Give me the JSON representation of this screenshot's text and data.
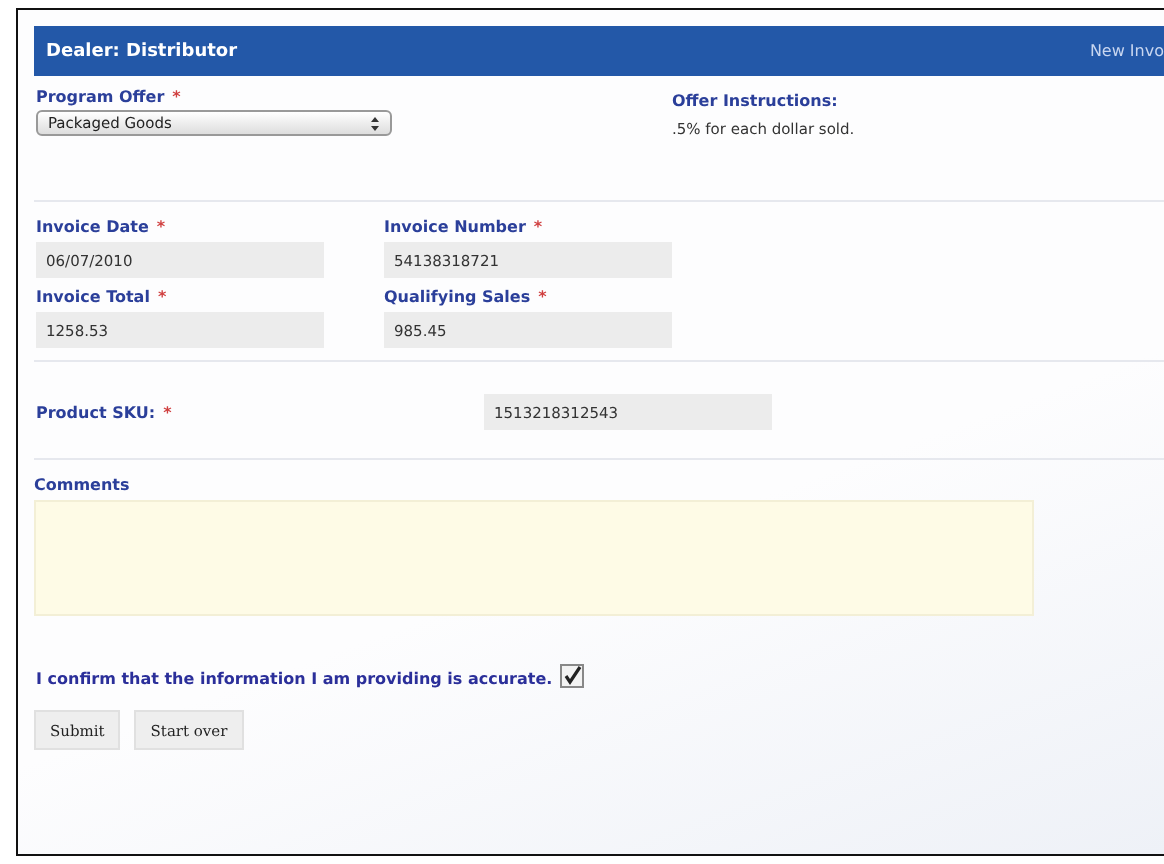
{
  "header": {
    "title": "Dealer: Distributor",
    "link": "New Invo"
  },
  "program_offer": {
    "label": "Program Offer",
    "required_mark": "*",
    "value": "Packaged Goods"
  },
  "offer_instructions": {
    "label": "Offer Instructions:",
    "text": ".5% for each dollar sold."
  },
  "fields": [
    {
      "label": "Invoice Date",
      "required_mark": "*",
      "value": "06/07/2010"
    },
    {
      "label": "Invoice Number",
      "required_mark": "*",
      "value": "54138318721"
    },
    {
      "label": "Invoice Total",
      "required_mark": "*",
      "value": "1258.53"
    },
    {
      "label": "Qualifying Sales",
      "required_mark": "*",
      "value": "985.45"
    }
  ],
  "sku": {
    "label": "Product SKU:",
    "required_mark": "*",
    "value": "1513218312543"
  },
  "comments": {
    "label": "Comments"
  },
  "confirm": {
    "label": "I confirm that the information I am providing is accurate.",
    "checked": true
  },
  "buttons": [
    "Submit",
    "Start over"
  ]
}
